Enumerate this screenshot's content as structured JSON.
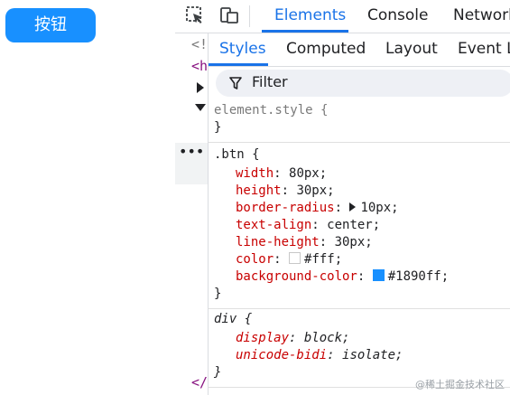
{
  "demo": {
    "button_label": "按钮",
    "button_color": "#1890ff"
  },
  "devtools": {
    "tabs": [
      "Elements",
      "Console",
      "Network"
    ],
    "active_tab": "Elements",
    "icons": [
      "inspect-element-icon",
      "device-toolbar-icon"
    ],
    "gutter": {
      "top_text": "<!",
      "html_fragment": "<h",
      "closing_fragment": "</"
    },
    "subtabs": [
      "Styles",
      "Computed",
      "Layout",
      "Event Li"
    ],
    "active_subtab": "Styles",
    "filter": {
      "placeholder": "Filter"
    },
    "rules": [
      {
        "selector": "element.style {",
        "close": "}",
        "properties": []
      },
      {
        "selector": ".btn {",
        "close": "}",
        "properties": [
          {
            "name": "width",
            "value": "80px;"
          },
          {
            "name": "height",
            "value": "30px;"
          },
          {
            "name": "border-radius",
            "value": "10px;"
          },
          {
            "name": "text-align",
            "value": "center;"
          },
          {
            "name": "line-height",
            "value": "30px;"
          },
          {
            "name": "color",
            "value": "#fff;",
            "swatch": "#ffffff"
          },
          {
            "name": "background-color",
            "value": "#1890ff;",
            "swatch": "#1890ff"
          }
        ]
      },
      {
        "selector": "div {",
        "close": "}",
        "properties": [
          {
            "name": "display",
            "value": "block;"
          },
          {
            "name": "unicode-bidi",
            "value": "isolate;"
          }
        ]
      }
    ]
  },
  "watermark": "@稀土掘金技术社区"
}
